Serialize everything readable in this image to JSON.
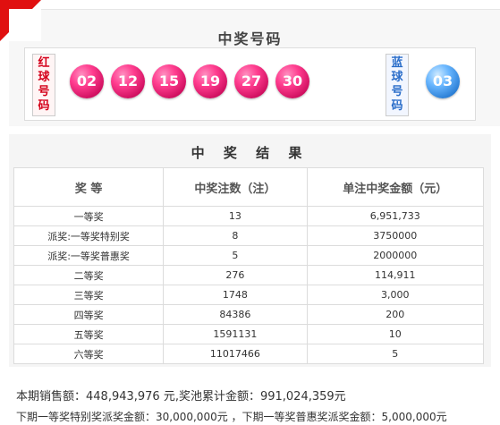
{
  "header": {
    "title": "中奖号码",
    "accent_color": "#e01010"
  },
  "red_tag": [
    "红",
    "球",
    "号",
    "码"
  ],
  "blue_tag": [
    "蓝",
    "球",
    "号",
    "码"
  ],
  "red_balls": [
    "02",
    "12",
    "15",
    "19",
    "27",
    "30"
  ],
  "blue_balls": [
    "03"
  ],
  "results": {
    "title": "中 奖 结 果",
    "columns": [
      "奖 等",
      "中奖注数（注）",
      "单注中奖金额（元）"
    ],
    "rows": [
      {
        "level": "一等奖",
        "count": "13",
        "amount": "6,951,733"
      },
      {
        "level": "派奖:一等奖特别奖",
        "count": "8",
        "amount": "3750000"
      },
      {
        "level": "派奖:一等奖普惠奖",
        "count": "5",
        "amount": "2000000"
      },
      {
        "level": "二等奖",
        "count": "276",
        "amount": "114,911"
      },
      {
        "level": "三等奖",
        "count": "1748",
        "amount": "3,000"
      },
      {
        "level": "四等奖",
        "count": "84386",
        "amount": "200"
      },
      {
        "level": "五等奖",
        "count": "1591131",
        "amount": "10"
      },
      {
        "level": "六等奖",
        "count": "11017466",
        "amount": "5"
      }
    ]
  },
  "summary": {
    "line1": "本期销售额：448,943,976 元,奖池累计金额：991,024,359元",
    "line2": "下期一等奖特别奖派奖金额：30,000,000元 ，下期一等奖普惠奖派奖金额：5,000,000元"
  }
}
